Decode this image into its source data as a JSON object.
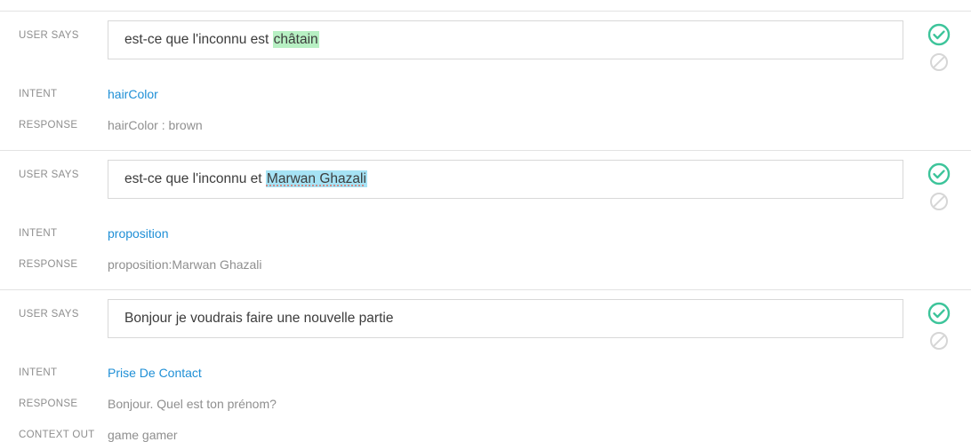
{
  "labels": {
    "user_says": "USER SAYS",
    "intent": "INTENT",
    "response": "RESPONSE",
    "context_out": "CONTEXT OUT"
  },
  "colors": {
    "accent_link": "#1f8fd6",
    "approve_icon": "#3cc49a",
    "reject_icon": "#d6d6d6",
    "highlight_green": "#b7f0c3",
    "highlight_blue": "#a6e3f5"
  },
  "entries": [
    {
      "says_before": "est-ce que l'inconnu est ",
      "says_highlight": "châtain",
      "says_after": "",
      "intent": "hairColor",
      "response": "hairColor : brown"
    },
    {
      "says_before": "est-ce que l'inconnu et ",
      "says_highlight": "Marwan Ghazali",
      "says_after": "",
      "intent": "proposition",
      "response": "proposition:Marwan Ghazali"
    },
    {
      "says_text": "Bonjour je voudrais faire une nouvelle partie",
      "intent": "Prise De Contact",
      "response": "Bonjour. Quel est ton prénom?",
      "context_out": "game gamer"
    }
  ]
}
